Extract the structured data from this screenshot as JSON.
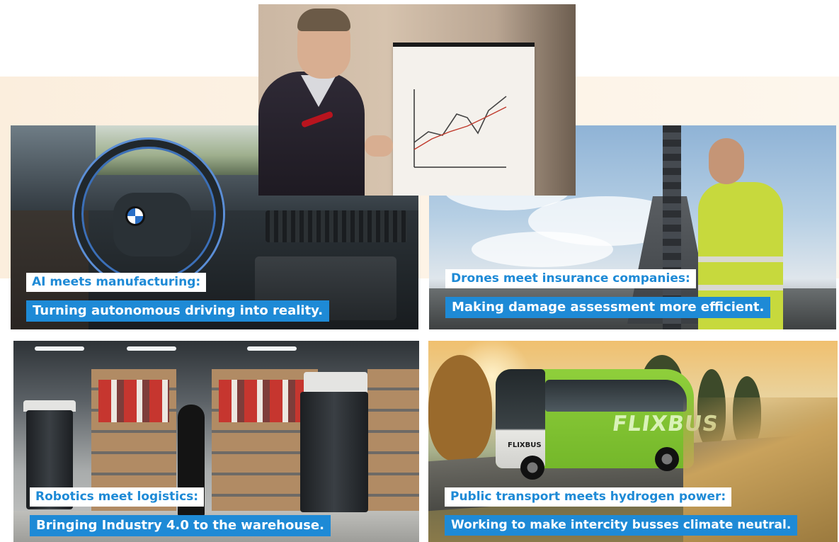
{
  "tiles": {
    "car": {
      "headline": "AI meets manufacturing:",
      "subline": "Turning autonomous driving into reality."
    },
    "drone": {
      "headline": "Drones meet insurance companies:",
      "subline": "Making damage assessment more efficient."
    },
    "warehouse": {
      "headline": "Robotics meet logistics:",
      "subline": "Bringing Industry 4.0 to the warehouse."
    },
    "bus": {
      "headline": "Public transport meets hydrogen power:",
      "subline": "Working to make intercity busses climate neutral.",
      "brand_side": "FLIXBUS",
      "brand_front": "FLIXBUS"
    }
  },
  "colors": {
    "caption_blue": "#1e8ad6",
    "caption_white": "#ffffff",
    "band": "#fbeedd"
  }
}
